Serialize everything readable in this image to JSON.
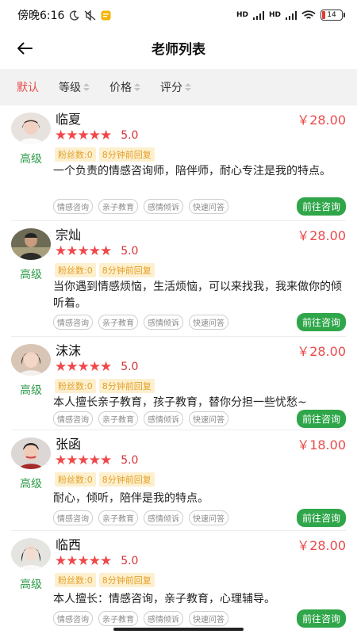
{
  "status_bar": {
    "time": "傍晚6:16",
    "network1": "HD",
    "network2": "HD",
    "battery": "14"
  },
  "nav": {
    "title": "老师列表"
  },
  "filters": [
    {
      "label": "默认",
      "active": true
    },
    {
      "label": "等级",
      "active": false
    },
    {
      "label": "价格",
      "active": false
    },
    {
      "label": "评分",
      "active": false
    }
  ],
  "teachers": [
    {
      "name": "临夏",
      "price": "￥28.00",
      "level": "高级",
      "stars": "★★★★★",
      "score": "5.0",
      "fans": "粉丝数:0",
      "reply": "8分钟前回复",
      "intro": "一个负责的情感咨询师，陪伴师，耐心专注是我的特点。",
      "tags": [
        "情感咨询",
        "亲子教育",
        "感情倾诉",
        "快速问答"
      ],
      "button": "前往咨询"
    },
    {
      "name": "宗灿",
      "price": "￥28.00",
      "level": "高级",
      "stars": "★★★★★",
      "score": "5.0",
      "fans": "粉丝数:0",
      "reply": "8分钟前回复",
      "intro": "当你遇到情感烦恼，生活烦恼，可以来找我，我来做你的倾听着。",
      "tags": [
        "情感咨询",
        "亲子教育",
        "感情倾诉",
        "快速问答"
      ],
      "button": "前往咨询"
    },
    {
      "name": "沫沫",
      "price": "￥28.00",
      "level": "高级",
      "stars": "★★★★★",
      "score": "5.0",
      "fans": "粉丝数:0",
      "reply": "8分钟前回复",
      "intro": "本人擅长亲子教育，孩子教育，替你分担一些忧愁~",
      "tags": [
        "情感咨询",
        "亲子教育",
        "感情倾诉",
        "快速问答"
      ],
      "button": "前往咨询"
    },
    {
      "name": "张函",
      "price": "￥18.00",
      "level": "高级",
      "stars": "★★★★★",
      "score": "5.0",
      "fans": "粉丝数:0",
      "reply": "8分钟前回复",
      "intro": "耐心，倾听，陪伴是我的特点。",
      "tags": [
        "情感咨询",
        "亲子教育",
        "感情倾诉",
        "快速问答"
      ],
      "button": "前往咨询"
    },
    {
      "name": "临西",
      "price": "￥28.00",
      "level": "高级",
      "stars": "★★★★★",
      "score": "5.0",
      "fans": "粉丝数:0",
      "reply": "8分钟前回复",
      "intro": "本人擅长：情感咨询，亲子教育，心理辅导。",
      "tags": [
        "情感咨询",
        "亲子教育",
        "感情倾诉",
        "快速问答"
      ],
      "button": "前往咨询"
    }
  ]
}
